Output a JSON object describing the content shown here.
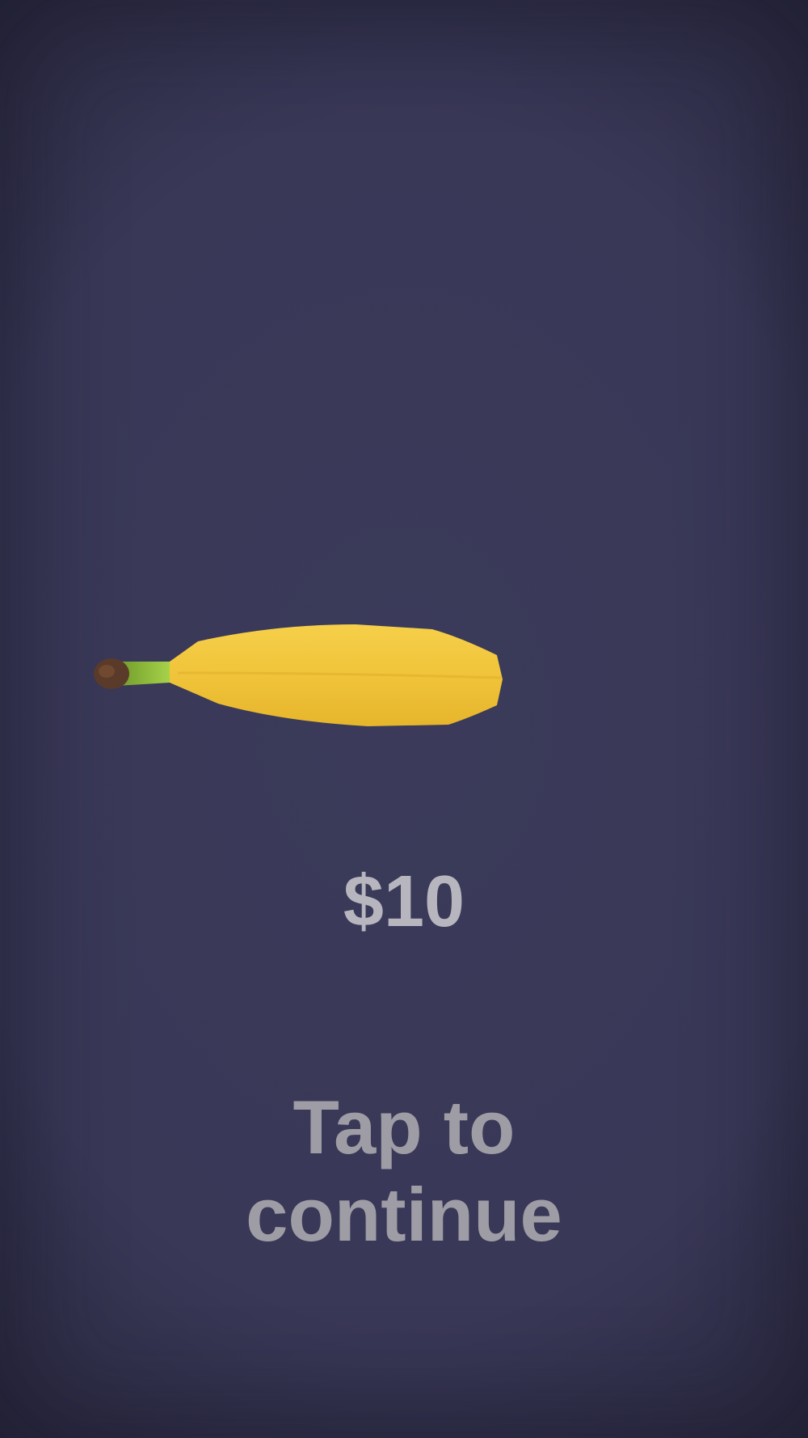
{
  "item": {
    "icon": "banana",
    "price_text": "$10"
  },
  "prompt": {
    "line1": "Tap to",
    "line2": "continue"
  },
  "colors": {
    "background": "#393857",
    "price_text": "#b7b6bf",
    "prompt_text": "#9e9da5",
    "banana_yellow": "#f2c33a",
    "banana_stem": "#8cc63a"
  }
}
